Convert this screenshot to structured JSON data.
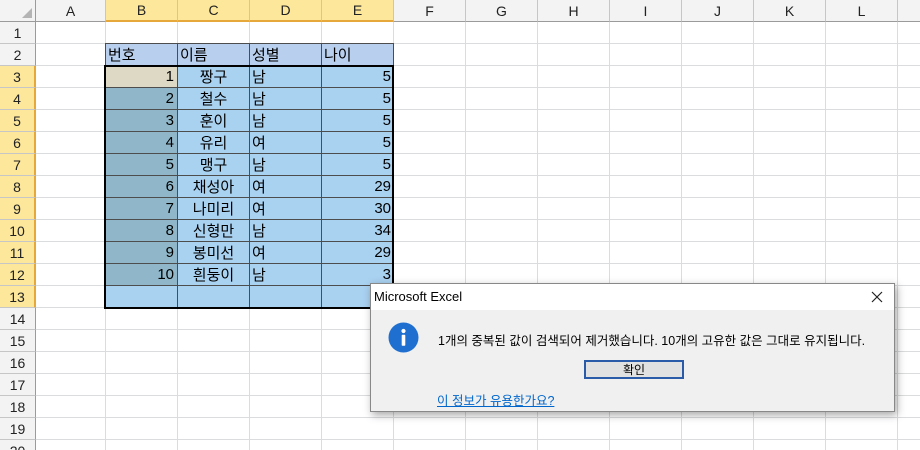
{
  "columns": [
    "A",
    "B",
    "C",
    "D",
    "E",
    "F",
    "G",
    "H",
    "I",
    "J",
    "K",
    "L"
  ],
  "rows": [
    "1",
    "2",
    "3",
    "4",
    "5",
    "6",
    "7",
    "8",
    "9",
    "10",
    "11",
    "12",
    "13",
    "14",
    "15",
    "16",
    "17",
    "18",
    "19",
    "20"
  ],
  "table": {
    "headers": [
      "번호",
      "이름",
      "성별",
      "나이"
    ],
    "rows": [
      {
        "no": "1",
        "name": "짱구",
        "gender": "남",
        "age": "5"
      },
      {
        "no": "2",
        "name": "철수",
        "gender": "남",
        "age": "5"
      },
      {
        "no": "3",
        "name": "훈이",
        "gender": "남",
        "age": "5"
      },
      {
        "no": "4",
        "name": "유리",
        "gender": "여",
        "age": "5"
      },
      {
        "no": "5",
        "name": "맹구",
        "gender": "남",
        "age": "5"
      },
      {
        "no": "6",
        "name": "채성아",
        "gender": "여",
        "age": "29"
      },
      {
        "no": "7",
        "name": "나미리",
        "gender": "여",
        "age": "30"
      },
      {
        "no": "8",
        "name": "신형만",
        "gender": "남",
        "age": "34"
      },
      {
        "no": "9",
        "name": "봉미선",
        "gender": "여",
        "age": "29"
      },
      {
        "no": "10",
        "name": "흰둥이",
        "gender": "남",
        "age": "3"
      }
    ]
  },
  "dialog": {
    "title": "Microsoft Excel",
    "icon": "info-icon",
    "message": "1개의 중복된 값이 검색되어 제거했습니다. 10개의 고유한 값은 그대로 유지됩니다.",
    "ok_label": "확인",
    "help_link": "이 정보가 유용한가요?",
    "close_icon": "close-icon"
  },
  "colors": {
    "header_fill": "#b8d0ee",
    "number_fill": "#8fb7c9",
    "data_fill": "#a9d1f0",
    "selected_header": "#fce79a",
    "info_icon": "#1f6fd1"
  }
}
